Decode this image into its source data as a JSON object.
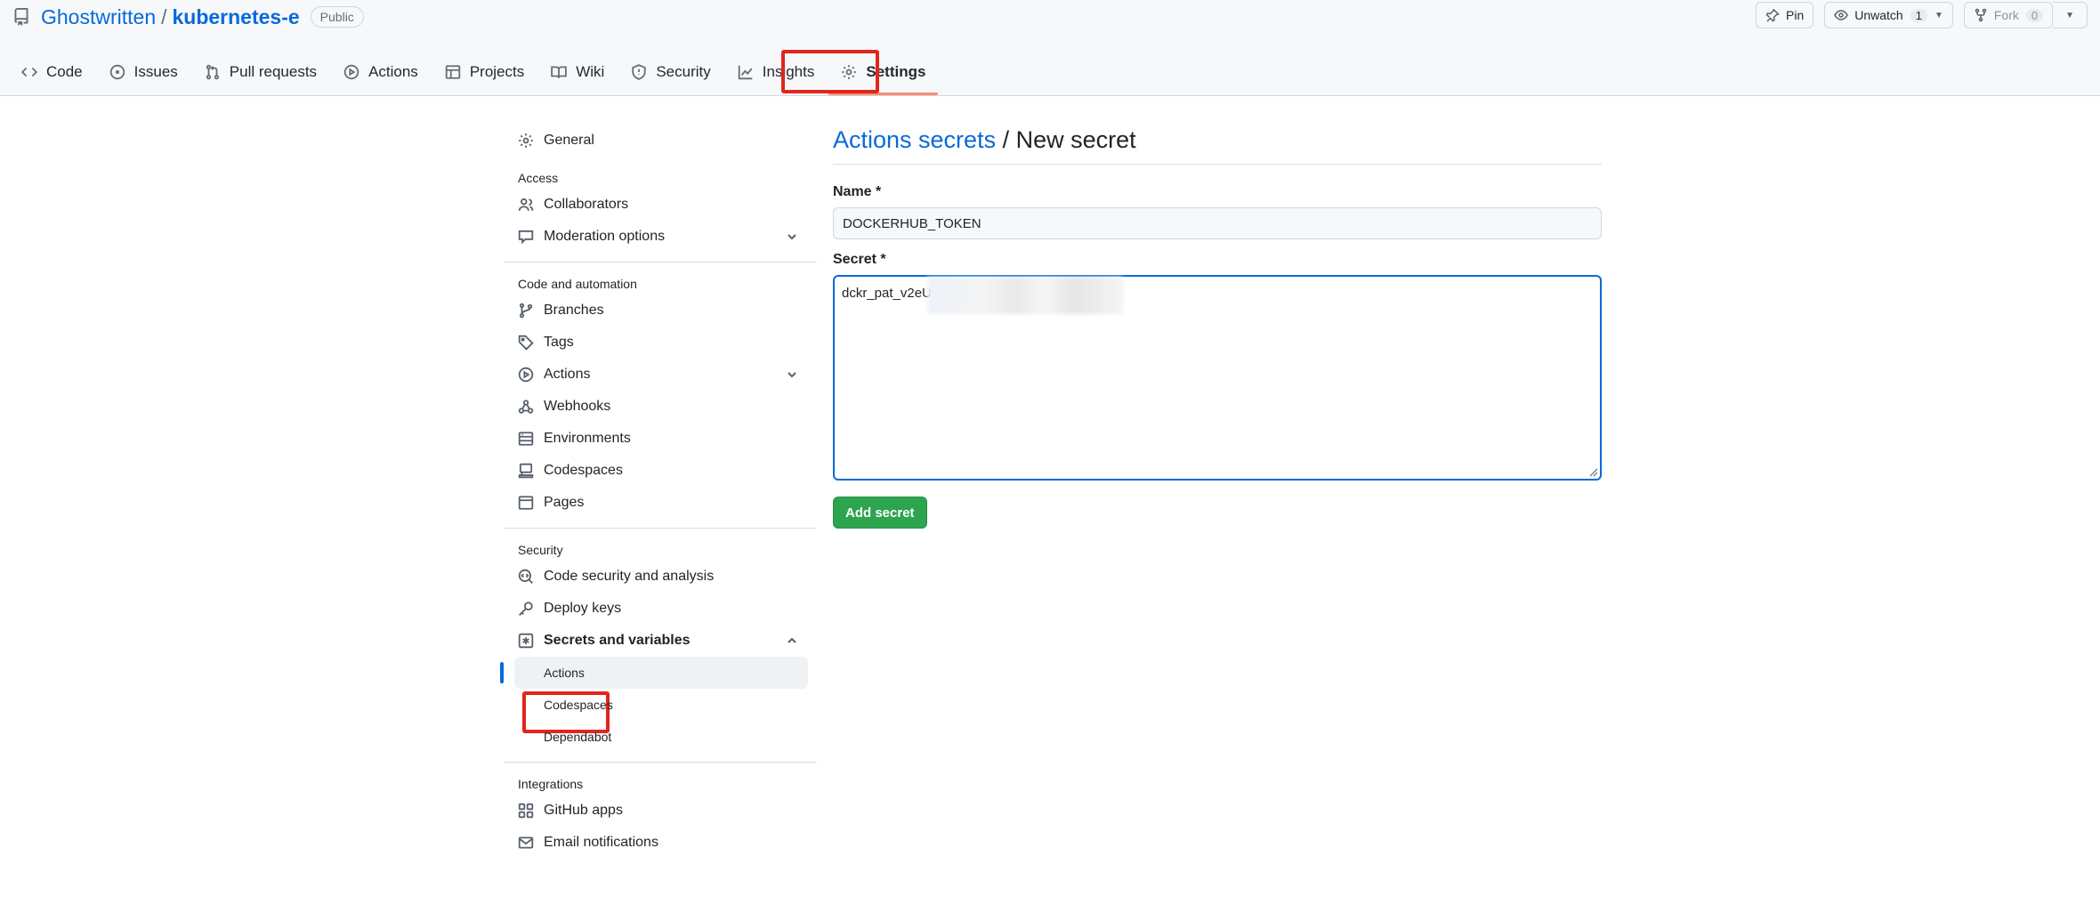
{
  "repo": {
    "owner": "Ghostwritten",
    "separator": "/",
    "name": "kubernetes-e",
    "visibility": "Public"
  },
  "top_actions": {
    "pin": "Pin",
    "unwatch": "Unwatch",
    "unwatch_count": "1",
    "fork": "Fork",
    "fork_count": "0"
  },
  "tabs": [
    {
      "label": "Code",
      "icon": "code-icon"
    },
    {
      "label": "Issues",
      "icon": "issue-icon"
    },
    {
      "label": "Pull requests",
      "icon": "pull-request-icon"
    },
    {
      "label": "Actions",
      "icon": "play-icon"
    },
    {
      "label": "Projects",
      "icon": "table-icon"
    },
    {
      "label": "Wiki",
      "icon": "book-icon"
    },
    {
      "label": "Security",
      "icon": "shield-icon"
    },
    {
      "label": "Insights",
      "icon": "graph-icon"
    },
    {
      "label": "Settings",
      "icon": "gear-icon",
      "active": true
    }
  ],
  "sidebar": {
    "general": "General",
    "access_heading": "Access",
    "collaborators": "Collaborators",
    "moderation": "Moderation options",
    "code_automation_heading": "Code and automation",
    "branches": "Branches",
    "tags": "Tags",
    "actions": "Actions",
    "webhooks": "Webhooks",
    "environments": "Environments",
    "codespaces": "Codespaces",
    "pages": "Pages",
    "security_heading": "Security",
    "code_security": "Code security and analysis",
    "deploy_keys": "Deploy keys",
    "secrets_variables": "Secrets and variables",
    "sub_actions": "Actions",
    "sub_codespaces": "Codespaces",
    "sub_dependabot": "Dependabot",
    "integrations_heading": "Integrations",
    "github_apps": "GitHub apps",
    "email_notifications": "Email notifications"
  },
  "main": {
    "heading_link": "Actions secrets",
    "heading_sep": " / ",
    "heading_current": "New secret",
    "name_label": "Name *",
    "name_value": "DOCKERHUB_TOKEN",
    "secret_label": "Secret *",
    "secret_value": "dckr_pat_v2eU",
    "submit_label": "Add secret"
  },
  "colors": {
    "accent": "#0969da",
    "primary_button": "#2da44e",
    "highlight": "#e1261c",
    "active_tab_underline": "#fd8c73"
  }
}
